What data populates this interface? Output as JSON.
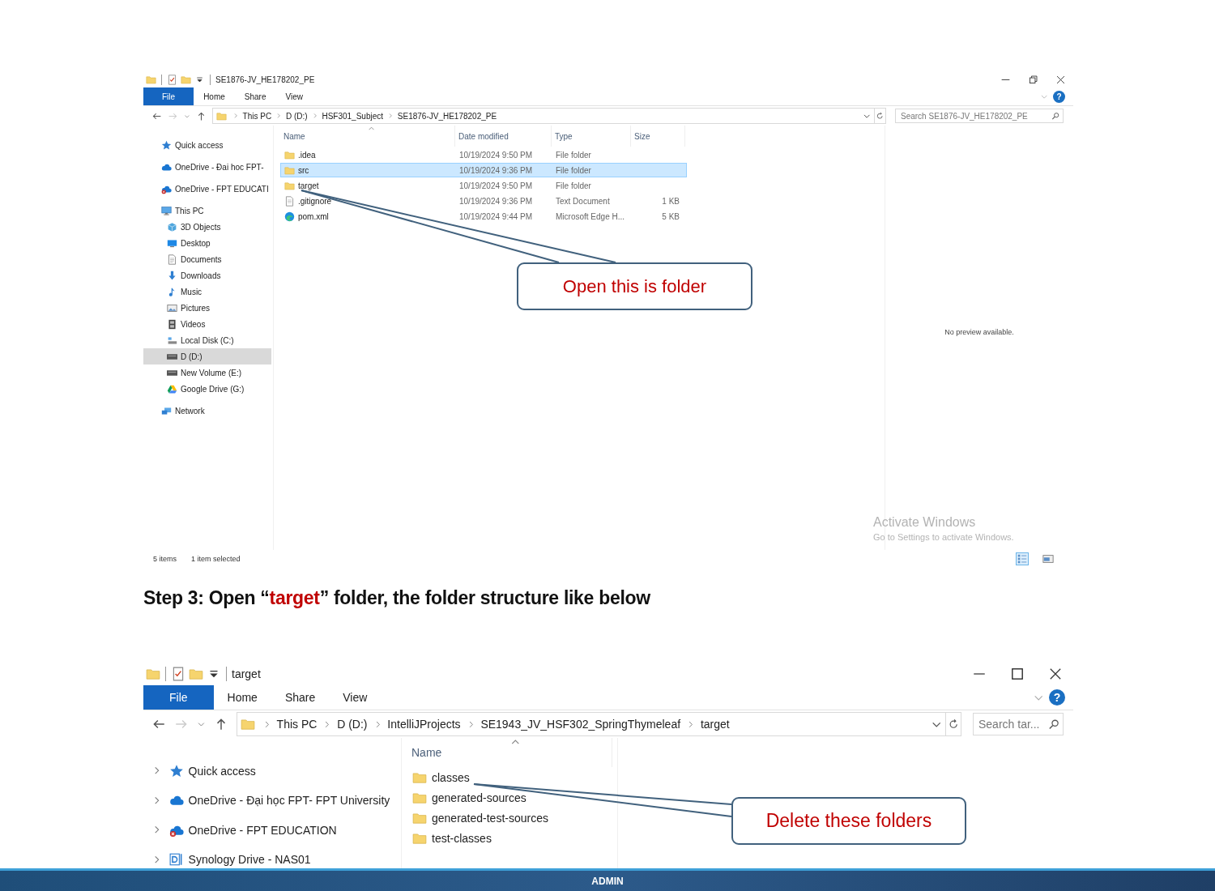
{
  "sections": [
    {
      "kind": "explorer",
      "title": "SE1876-JV_HE178202_PE",
      "maximized": true,
      "ribbon_tabs": [
        {
          "label": "File",
          "kind": "menu"
        },
        {
          "label": "Home",
          "kind": "tab"
        },
        {
          "label": "Share",
          "kind": "tab"
        },
        {
          "label": "View",
          "kind": "tab"
        }
      ],
      "help_button": {
        "glyph": "?"
      },
      "breadcrumb": [
        "This PC",
        "D (D:)",
        "HSF301_Subject",
        "SE1876-JV_HE178202_PE"
      ],
      "search": {
        "placeholder": "Search SE1876-JV_HE178202_PE"
      },
      "nav": [
        {
          "label": "Quick access",
          "kind": "quickaccess",
          "selected": false
        },
        {
          "label": "OneDrive - Đai hoc FPT-",
          "kind": "cloud",
          "selected": false
        },
        {
          "label": "OneDrive - FPT EDUCATI",
          "kind": "clouderror",
          "selected": false
        },
        {
          "label": "This PC",
          "kind": "computer",
          "selected": false,
          "children": [
            {
              "label": "3D Objects",
              "kind": "objects",
              "selected": false
            },
            {
              "label": "Desktop",
              "kind": "desktop",
              "selected": false
            },
            {
              "label": "Documents",
              "kind": "documents",
              "selected": false
            },
            {
              "label": "Downloads",
              "kind": "downloads",
              "selected": false
            },
            {
              "label": "Music",
              "kind": "music",
              "selected": false
            },
            {
              "label": "Pictures",
              "kind": "pictures",
              "selected": false
            },
            {
              "label": "Videos",
              "kind": "videos",
              "selected": false
            },
            {
              "label": "Local Disk (C:)",
              "kind": "systemdisk",
              "selected": false
            },
            {
              "label": "D (D:)",
              "kind": "drive",
              "selected": true
            },
            {
              "label": "New Volume (E:)",
              "kind": "drive",
              "selected": false
            },
            {
              "label": "Google Drive (G:)",
              "kind": "googledrive",
              "selected": false
            }
          ]
        },
        {
          "label": "Network",
          "kind": "network",
          "selected": false
        }
      ],
      "columns": [
        "Name",
        "Date modified",
        "Type",
        "Size"
      ],
      "files": [
        {
          "name": ".idea",
          "kind": "folder",
          "date": "10/19/2024 9:50 PM",
          "type": "File folder",
          "selected": false
        },
        {
          "name": "src",
          "kind": "folder",
          "date": "10/19/2024 9:36 PM",
          "type": "File folder",
          "selected": true
        },
        {
          "name": "target",
          "kind": "folder",
          "date": "10/19/2024 9:50 PM",
          "type": "File folder",
          "selected": false
        },
        {
          "name": ".gitignore",
          "kind": "text",
          "date": "10/19/2024 9:36 PM",
          "type": "Text Document",
          "size": "1 KB",
          "selected": false
        },
        {
          "name": "pom.xml",
          "kind": "edge",
          "date": "10/19/2024 9:44 PM",
          "type": "Microsoft Edge H...",
          "size": "5 KB",
          "selected": false
        }
      ],
      "preview": {
        "text": "No preview available."
      },
      "activation_notice": {
        "title": "Activate Windows",
        "text": "Go to Settings to activate Windows."
      },
      "status": {
        "count": "5 items",
        "selection": "1 item selected"
      },
      "callout": {
        "text": "Open this is folder"
      }
    },
    {
      "kind": "heading",
      "parts": [
        {
          "text": "Step 3: Open “",
          "highlight": false
        },
        {
          "text": "target",
          "highlight": true
        },
        {
          "text": "” folder, the folder structure like below",
          "highlight": false
        }
      ]
    },
    {
      "kind": "explorer",
      "title": "target",
      "maximized": false,
      "ribbon_tabs": [
        {
          "label": "File",
          "kind": "menu"
        },
        {
          "label": "Home",
          "kind": "tab"
        },
        {
          "label": "Share",
          "kind": "tab"
        },
        {
          "label": "View",
          "kind": "tab"
        }
      ],
      "help_button": {
        "glyph": "?"
      },
      "breadcrumb": [
        "This PC",
        "D (D:)",
        "IntelliJProjects",
        "SE1943_JV_HSF302_SpringThymeleaf",
        "target"
      ],
      "search": {
        "placeholder": "Search tar..."
      },
      "nav": [
        {
          "label": "Quick access",
          "kind": "quickaccess",
          "selected": false,
          "expanded": false
        },
        {
          "label": "OneDrive - Đại học FPT- FPT University",
          "kind": "cloud",
          "selected": false,
          "expanded": false
        },
        {
          "label": "OneDrive - FPT EDUCATION",
          "kind": "clouderror",
          "selected": false,
          "expanded": false
        },
        {
          "label": "Synology Drive - NAS01",
          "kind": "synology",
          "selected": false,
          "expanded": false
        }
      ],
      "columns": [
        "Name"
      ],
      "files": [
        {
          "name": "classes",
          "kind": "folder",
          "selected": false
        },
        {
          "name": "generated-sources",
          "kind": "folder",
          "selected": false
        },
        {
          "name": "generated-test-sources",
          "kind": "folder",
          "selected": false
        },
        {
          "name": "test-classes",
          "kind": "folder",
          "selected": false
        }
      ],
      "callout": {
        "text": "Delete these folders"
      }
    }
  ],
  "footer_bar": {
    "label": "ADMIN"
  }
}
